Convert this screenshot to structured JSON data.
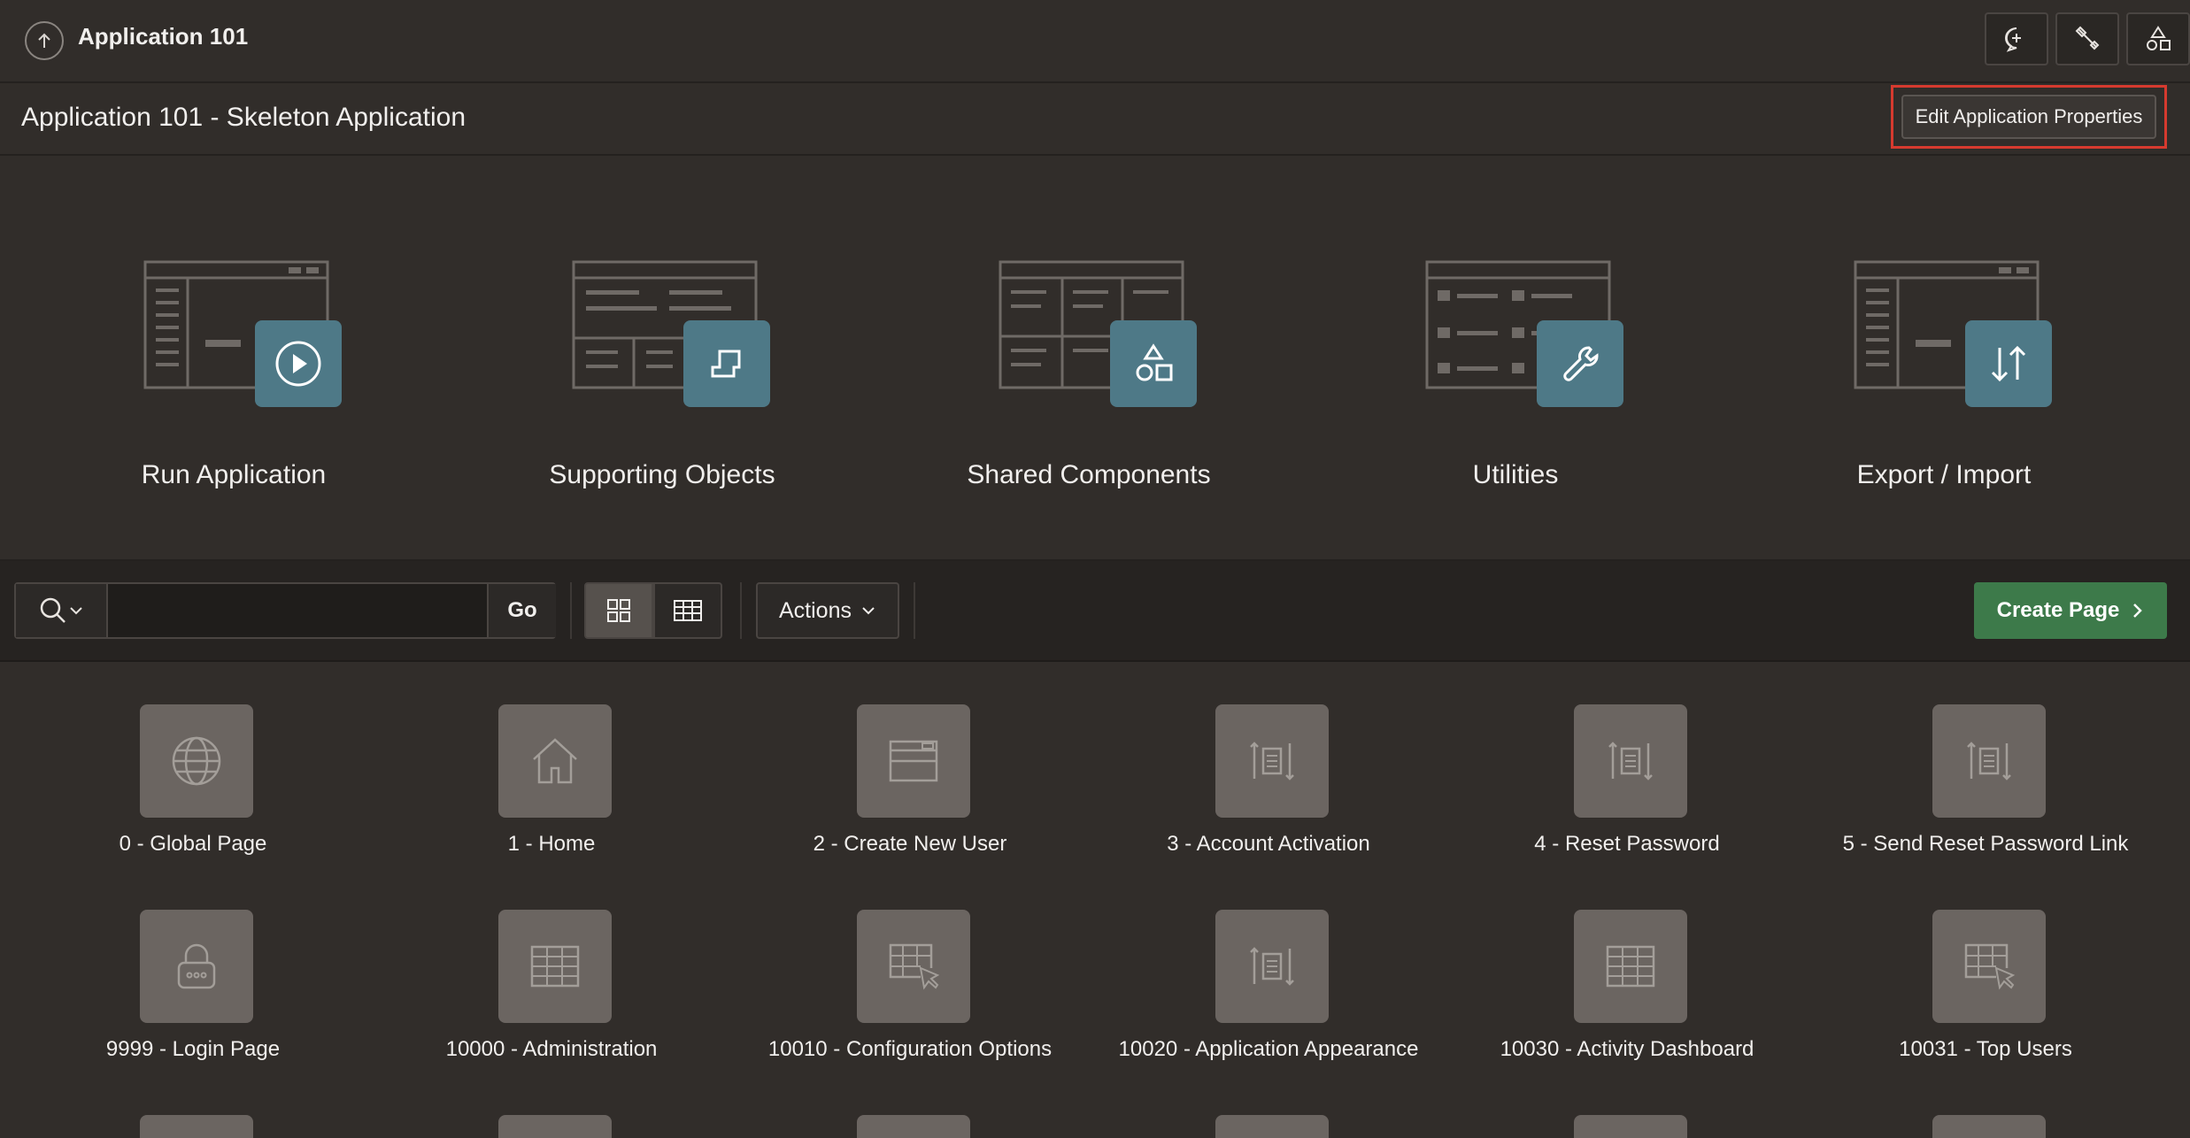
{
  "topbar": {
    "app_title": "Application 101"
  },
  "header": {
    "subtitle": "Application 101 - Skeleton Application",
    "edit_button": "Edit Application Properties"
  },
  "hero_cards": [
    {
      "label": "Run Application",
      "icon": "play-icon"
    },
    {
      "label": "Supporting Objects",
      "icon": "scroll-icon"
    },
    {
      "label": "Shared Components",
      "icon": "shapes-icon"
    },
    {
      "label": "Utilities",
      "icon": "wrench-icon"
    },
    {
      "label": "Export / Import",
      "icon": "export-import-icon"
    }
  ],
  "toolbar": {
    "search_placeholder": "",
    "go_label": "Go",
    "actions_label": "Actions",
    "create_label": "Create Page"
  },
  "pages": [
    {
      "name": "0 - Global Page",
      "icon": "globe-icon"
    },
    {
      "name": "1 - Home",
      "icon": "home-icon"
    },
    {
      "name": "2 - Create New User",
      "icon": "form-icon"
    },
    {
      "name": "3 - Account Activation",
      "icon": "process-icon"
    },
    {
      "name": "4 - Reset Password",
      "icon": "process-icon"
    },
    {
      "name": "5 - Send Reset Password Link",
      "icon": "process-icon"
    },
    {
      "name": "9999 - Login Page",
      "icon": "lock-icon"
    },
    {
      "name": "10000 - Administration",
      "icon": "grid-icon"
    },
    {
      "name": "10010 - Configuration Options",
      "icon": "interactive-grid-icon"
    },
    {
      "name": "10020 - Application Appearance",
      "icon": "process-icon"
    },
    {
      "name": "10030 - Activity Dashboard",
      "icon": "grid-icon"
    },
    {
      "name": "10031 - Top Users",
      "icon": "interactive-grid-icon"
    }
  ]
}
